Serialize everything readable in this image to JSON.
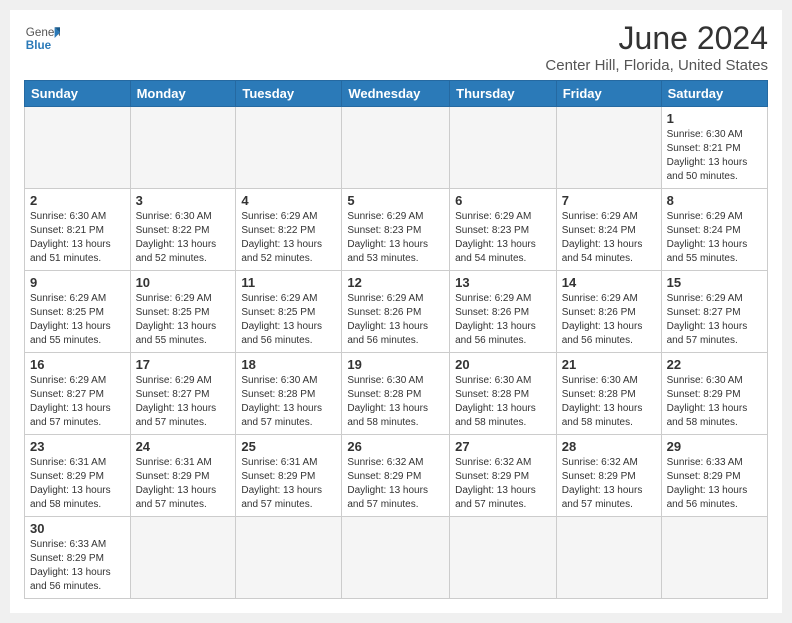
{
  "header": {
    "logo_general": "General",
    "logo_blue": "Blue",
    "month": "June 2024",
    "location": "Center Hill, Florida, United States"
  },
  "days_of_week": [
    "Sunday",
    "Monday",
    "Tuesday",
    "Wednesday",
    "Thursday",
    "Friday",
    "Saturday"
  ],
  "weeks": [
    [
      {
        "day": "",
        "info": ""
      },
      {
        "day": "",
        "info": ""
      },
      {
        "day": "",
        "info": ""
      },
      {
        "day": "",
        "info": ""
      },
      {
        "day": "",
        "info": ""
      },
      {
        "day": "",
        "info": ""
      },
      {
        "day": "1",
        "info": "Sunrise: 6:30 AM\nSunset: 8:21 PM\nDaylight: 13 hours\nand 50 minutes."
      }
    ],
    [
      {
        "day": "2",
        "info": "Sunrise: 6:30 AM\nSunset: 8:21 PM\nDaylight: 13 hours\nand 51 minutes."
      },
      {
        "day": "3",
        "info": "Sunrise: 6:30 AM\nSunset: 8:22 PM\nDaylight: 13 hours\nand 52 minutes."
      },
      {
        "day": "4",
        "info": "Sunrise: 6:29 AM\nSunset: 8:22 PM\nDaylight: 13 hours\nand 52 minutes."
      },
      {
        "day": "5",
        "info": "Sunrise: 6:29 AM\nSunset: 8:23 PM\nDaylight: 13 hours\nand 53 minutes."
      },
      {
        "day": "6",
        "info": "Sunrise: 6:29 AM\nSunset: 8:23 PM\nDaylight: 13 hours\nand 54 minutes."
      },
      {
        "day": "7",
        "info": "Sunrise: 6:29 AM\nSunset: 8:24 PM\nDaylight: 13 hours\nand 54 minutes."
      },
      {
        "day": "8",
        "info": "Sunrise: 6:29 AM\nSunset: 8:24 PM\nDaylight: 13 hours\nand 55 minutes."
      }
    ],
    [
      {
        "day": "9",
        "info": "Sunrise: 6:29 AM\nSunset: 8:25 PM\nDaylight: 13 hours\nand 55 minutes."
      },
      {
        "day": "10",
        "info": "Sunrise: 6:29 AM\nSunset: 8:25 PM\nDaylight: 13 hours\nand 55 minutes."
      },
      {
        "day": "11",
        "info": "Sunrise: 6:29 AM\nSunset: 8:25 PM\nDaylight: 13 hours\nand 56 minutes."
      },
      {
        "day": "12",
        "info": "Sunrise: 6:29 AM\nSunset: 8:26 PM\nDaylight: 13 hours\nand 56 minutes."
      },
      {
        "day": "13",
        "info": "Sunrise: 6:29 AM\nSunset: 8:26 PM\nDaylight: 13 hours\nand 56 minutes."
      },
      {
        "day": "14",
        "info": "Sunrise: 6:29 AM\nSunset: 8:26 PM\nDaylight: 13 hours\nand 56 minutes."
      },
      {
        "day": "15",
        "info": "Sunrise: 6:29 AM\nSunset: 8:27 PM\nDaylight: 13 hours\nand 57 minutes."
      }
    ],
    [
      {
        "day": "16",
        "info": "Sunrise: 6:29 AM\nSunset: 8:27 PM\nDaylight: 13 hours\nand 57 minutes."
      },
      {
        "day": "17",
        "info": "Sunrise: 6:29 AM\nSunset: 8:27 PM\nDaylight: 13 hours\nand 57 minutes."
      },
      {
        "day": "18",
        "info": "Sunrise: 6:30 AM\nSunset: 8:28 PM\nDaylight: 13 hours\nand 57 minutes."
      },
      {
        "day": "19",
        "info": "Sunrise: 6:30 AM\nSunset: 8:28 PM\nDaylight: 13 hours\nand 58 minutes."
      },
      {
        "day": "20",
        "info": "Sunrise: 6:30 AM\nSunset: 8:28 PM\nDaylight: 13 hours\nand 58 minutes."
      },
      {
        "day": "21",
        "info": "Sunrise: 6:30 AM\nSunset: 8:28 PM\nDaylight: 13 hours\nand 58 minutes."
      },
      {
        "day": "22",
        "info": "Sunrise: 6:30 AM\nSunset: 8:29 PM\nDaylight: 13 hours\nand 58 minutes."
      }
    ],
    [
      {
        "day": "23",
        "info": "Sunrise: 6:31 AM\nSunset: 8:29 PM\nDaylight: 13 hours\nand 58 minutes."
      },
      {
        "day": "24",
        "info": "Sunrise: 6:31 AM\nSunset: 8:29 PM\nDaylight: 13 hours\nand 57 minutes."
      },
      {
        "day": "25",
        "info": "Sunrise: 6:31 AM\nSunset: 8:29 PM\nDaylight: 13 hours\nand 57 minutes."
      },
      {
        "day": "26",
        "info": "Sunrise: 6:32 AM\nSunset: 8:29 PM\nDaylight: 13 hours\nand 57 minutes."
      },
      {
        "day": "27",
        "info": "Sunrise: 6:32 AM\nSunset: 8:29 PM\nDaylight: 13 hours\nand 57 minutes."
      },
      {
        "day": "28",
        "info": "Sunrise: 6:32 AM\nSunset: 8:29 PM\nDaylight: 13 hours\nand 57 minutes."
      },
      {
        "day": "29",
        "info": "Sunrise: 6:33 AM\nSunset: 8:29 PM\nDaylight: 13 hours\nand 56 minutes."
      }
    ],
    [
      {
        "day": "30",
        "info": "Sunrise: 6:33 AM\nSunset: 8:29 PM\nDaylight: 13 hours\nand 56 minutes."
      },
      {
        "day": "",
        "info": ""
      },
      {
        "day": "",
        "info": ""
      },
      {
        "day": "",
        "info": ""
      },
      {
        "day": "",
        "info": ""
      },
      {
        "day": "",
        "info": ""
      },
      {
        "day": "",
        "info": ""
      }
    ]
  ]
}
